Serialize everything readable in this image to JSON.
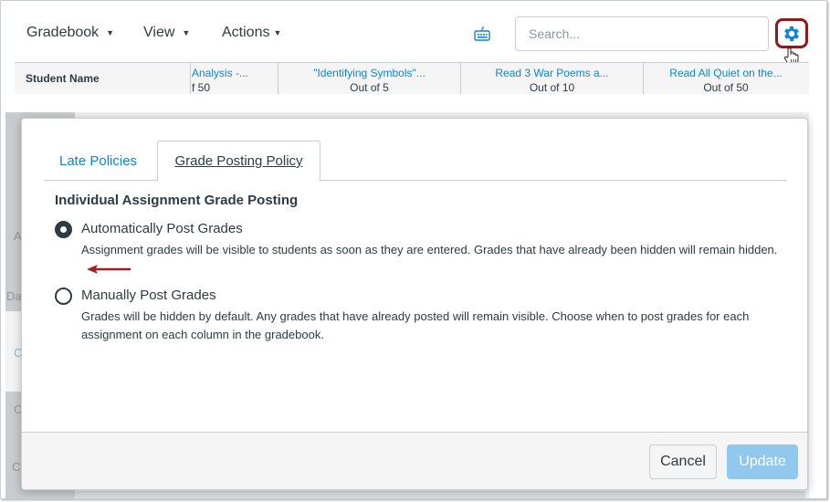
{
  "toolbar": {
    "menus": [
      {
        "label": "Gradebook",
        "icon": "caret-down-icon"
      },
      {
        "label": "View",
        "icon": "caret-down-icon"
      },
      {
        "label": "Actions",
        "icon": "caret-down-icon"
      }
    ],
    "keyboard_icon": "keyboard-icon",
    "search": {
      "placeholder": "Search...",
      "value": ""
    },
    "settings_icon": "gear-icon",
    "highlight_color": "#8f1a1d",
    "accent_color": "#0e84d5"
  },
  "grid": {
    "student_header": "Student Name",
    "columns": [
      {
        "name": "Analysis -...",
        "points": "f 50"
      },
      {
        "name": "\"Identifying Symbols\"...",
        "points": "Out of 5"
      },
      {
        "name": "Read 3 War Poems a...",
        "points": "Out of 10"
      },
      {
        "name": "Read All Quiet on the...",
        "points": "Out of 50"
      }
    ]
  },
  "background_letters": [
    "A",
    "Da",
    "C",
    "C",
    "C"
  ],
  "modal": {
    "tabs": [
      {
        "label": "Late Policies",
        "active": false
      },
      {
        "label": "Grade Posting Policy",
        "active": true
      }
    ],
    "section_title": "Individual Assignment Grade Posting",
    "options": [
      {
        "label": "Automatically Post Grades",
        "description": "Assignment grades will be visible to students as soon as they are entered. Grades that have already been hidden will remain hidden.",
        "checked": true
      },
      {
        "label": "Manually Post Grades",
        "description": "Grades will be hidden by default. Any grades that have already posted will remain visible. Choose when to post grades for each assignment on each column in the gradebook.",
        "checked": false
      }
    ],
    "annotation": {
      "icon": "arrow-left-icon",
      "color": "#a01e22"
    },
    "buttons": {
      "cancel": "Cancel",
      "update": "Update",
      "update_disabled": true
    }
  }
}
